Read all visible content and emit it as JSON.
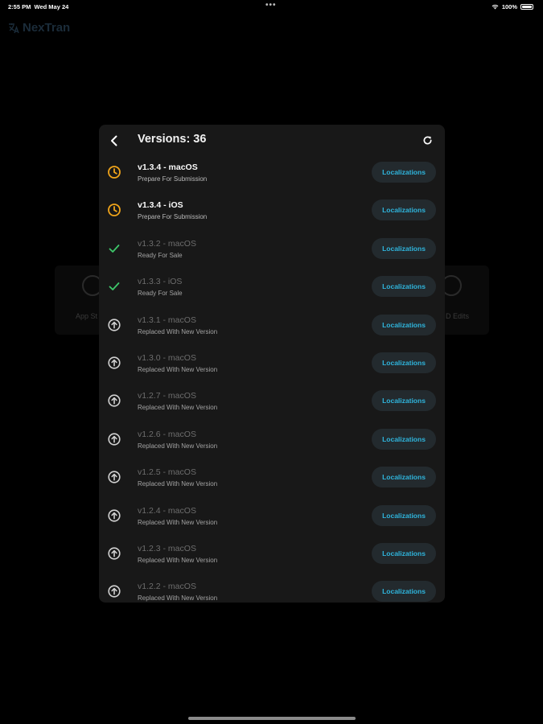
{
  "status_bar": {
    "time": "2:55 PM",
    "date": "Wed May 24",
    "battery": "100%"
  },
  "background": {
    "brand_name": "NexTran",
    "card_left_label": "App St",
    "card_right_label": "D Edits"
  },
  "modal": {
    "title": "Versions: 36",
    "colors": {
      "pending": "#f0a41a",
      "ready": "#3ec76a",
      "replaced": "#d0d0d0",
      "button_text": "#2fb5dd"
    },
    "versions": [
      {
        "name": "v1.3.4 - macOS",
        "status": "Prepare For Submission",
        "icon": "clock-icon",
        "button": "Localizations",
        "dim": false
      },
      {
        "name": "v1.3.4 - iOS",
        "status": "Prepare For Submission",
        "icon": "clock-icon",
        "button": "Localizations",
        "dim": false
      },
      {
        "name": "v1.3.2 - macOS",
        "status": "Ready For Sale",
        "icon": "checkmark-icon",
        "button": "Localizations",
        "dim": true
      },
      {
        "name": "v1.3.3 - iOS",
        "status": "Ready For Sale",
        "icon": "checkmark-icon",
        "button": "Localizations",
        "dim": true
      },
      {
        "name": "v1.3.1 - macOS",
        "status": "Replaced With New Version",
        "icon": "arrow-up-circle-icon",
        "button": "Localizations",
        "dim": true
      },
      {
        "name": "v1.3.0 - macOS",
        "status": "Replaced With New Version",
        "icon": "arrow-up-circle-icon",
        "button": "Localizations",
        "dim": true
      },
      {
        "name": "v1.2.7 - macOS",
        "status": "Replaced With New Version",
        "icon": "arrow-up-circle-icon",
        "button": "Localizations",
        "dim": true
      },
      {
        "name": "v1.2.6 - macOS",
        "status": "Replaced With New Version",
        "icon": "arrow-up-circle-icon",
        "button": "Localizations",
        "dim": true
      },
      {
        "name": "v1.2.5 - macOS",
        "status": "Replaced With New Version",
        "icon": "arrow-up-circle-icon",
        "button": "Localizations",
        "dim": true
      },
      {
        "name": "v1.2.4 - macOS",
        "status": "Replaced With New Version",
        "icon": "arrow-up-circle-icon",
        "button": "Localizations",
        "dim": true
      },
      {
        "name": "v1.2.3 - macOS",
        "status": "Replaced With New Version",
        "icon": "arrow-up-circle-icon",
        "button": "Localizations",
        "dim": true
      },
      {
        "name": "v1.2.2 - macOS",
        "status": "Replaced With New Version",
        "icon": "arrow-up-circle-icon",
        "button": "Localizations",
        "dim": true
      }
    ]
  }
}
